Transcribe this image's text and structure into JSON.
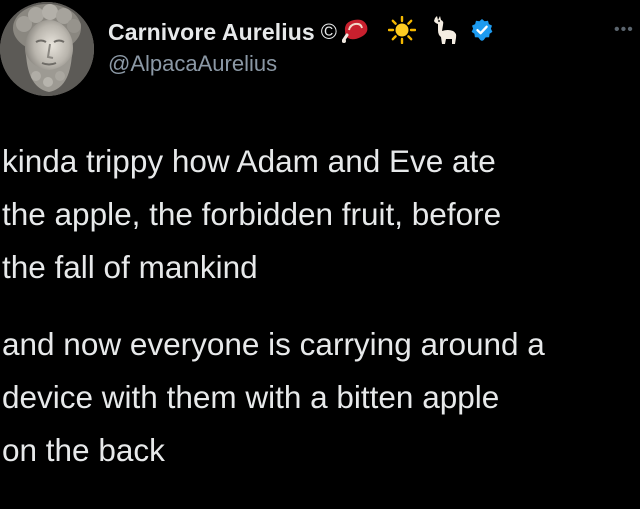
{
  "author": {
    "display_name": "Carnivore Aurelius",
    "copyright_symbol": "©",
    "handle": "@AlpacaAurelius",
    "name_icons": [
      "steak-icon",
      "sun-icon",
      "llama-icon",
      "verified-badge-icon"
    ]
  },
  "menu": {
    "more_label": "•••"
  },
  "tweet": {
    "paragraph1": [
      "kinda trippy how Adam and Eve ate",
      "the apple, the forbidden fruit, before",
      "the fall of mankind"
    ],
    "paragraph2": [
      "and now everyone is carrying around a",
      "device with them with a bitten apple",
      "on the back"
    ]
  },
  "colors": {
    "background": "#000000",
    "text": "#e7e9ea",
    "secondary_text": "#8b98a5",
    "verified_blue": "#1d9bf0"
  }
}
